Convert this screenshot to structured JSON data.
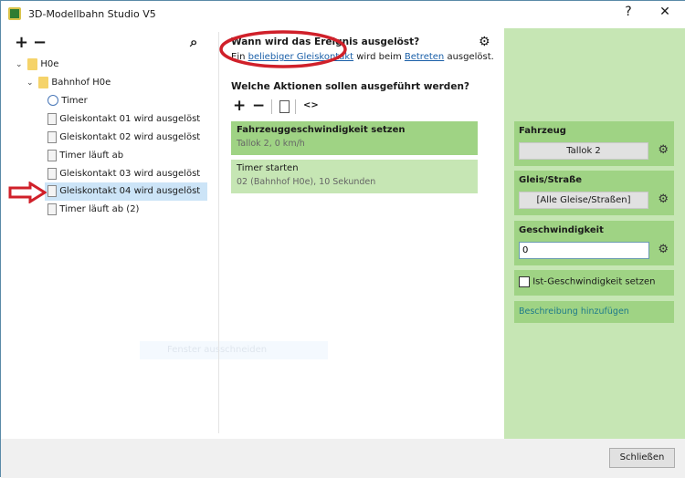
{
  "window": {
    "title": "3D-Modellbahn Studio V5",
    "help": "?",
    "close": "✕"
  },
  "tree": {
    "add": "+",
    "remove": "−",
    "search": "⌕",
    "root": "H0e",
    "folder": "Bahnhof H0e",
    "items": [
      "Timer",
      "Gleiskontakt 01 wird ausgelöst",
      "Gleiskontakt  02 wird ausgelöst",
      "Timer läuft ab",
      "Gleiskontakt 03 wird ausgelöst",
      "Gleiskontakt 04 wird ausgelöst",
      "Timer läuft ab (2)"
    ],
    "selected_index": 5
  },
  "trigger": {
    "heading": "Wann wird das Ereignis ausgelöst?",
    "pre": "Ein ",
    "link1": "beliebiger Gleiskontakt",
    "mid": " wird beim ",
    "link2": "Betreten",
    "post": " ausgelöst."
  },
  "actions": {
    "heading": "Welche Aktionen sollen ausgeführt werden?",
    "add": "+",
    "remove": "−",
    "code": "<>",
    "list": [
      {
        "title": "Fahrzeuggeschwindigkeit setzen",
        "detail": "Tallok 2, 0 km/h"
      },
      {
        "title": "Timer starten",
        "detail": "02 (Bahnhof H0e), 10 Sekunden"
      }
    ]
  },
  "ghost": "Fenster ausschneiden",
  "props": {
    "vehicle_label": "Fahrzeug",
    "vehicle_value": "Tallok 2",
    "track_label": "Gleis/Straße",
    "track_value": "[Alle Gleise/Straßen]",
    "speed_label": "Geschwindigkeit",
    "speed_value": "0",
    "checkbox_label": "Ist-Geschwindigkeit setzen",
    "description_link": "Beschreibung hinzufügen"
  },
  "footer": {
    "close_button": "Schließen"
  },
  "colors": {
    "selected_card": "#9fd384",
    "card": "#c6e6b4",
    "annotation": "#d0202a"
  }
}
